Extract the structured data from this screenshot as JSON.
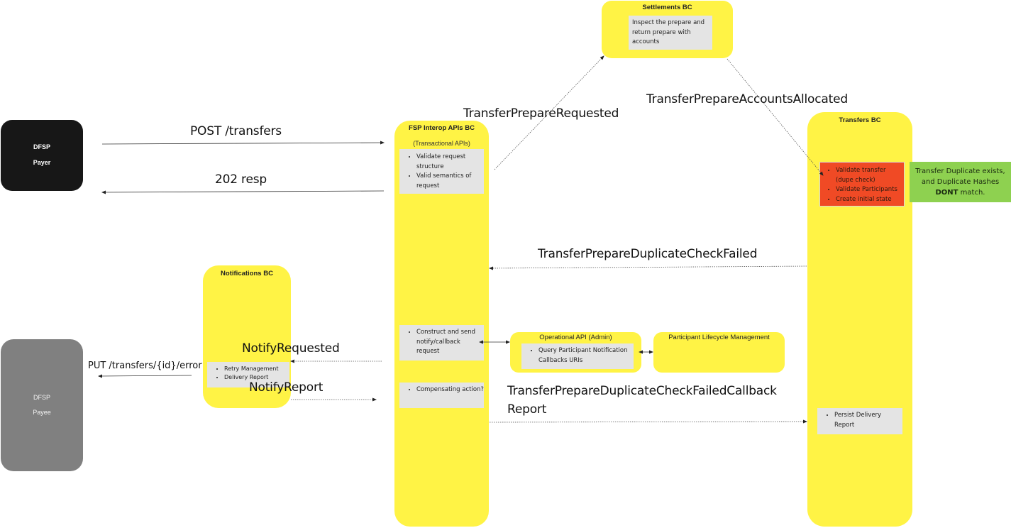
{
  "diagram_title": "",
  "colors": {
    "bounded_context": "#fff345",
    "card": "#e4e4e4",
    "error_card": "#f04a25",
    "note": "#8ed150",
    "payer": "#171717",
    "payee": "#808080"
  },
  "actors": {
    "payer": {
      "line1": "DFSP",
      "line2": "Payer"
    },
    "payee": {
      "line1": "DFSP",
      "line2": "Payee"
    }
  },
  "settlements_bc": {
    "title": "Settlements BC",
    "card_text": "Inspect the prepare and return prepare with accounts"
  },
  "fsp_interop_bc": {
    "title": "FSP Interop APIs BC",
    "subtitle": "(Transactional APIs)",
    "card1": [
      "Validate request structure",
      "Valid semantics of request"
    ],
    "card2": [
      "Construct and send notify/callback request"
    ],
    "card3": [
      "Compensating action?"
    ]
  },
  "transfers_bc": {
    "title": "Transfers BC",
    "error_card": [
      "Validate transfer (dupe check)",
      "Validate Participants",
      "Create initial state"
    ],
    "card2": [
      "Persist Delivery Report"
    ]
  },
  "note": {
    "text_before": "Transfer Duplicate exists, and Duplicate Hashes ",
    "bold": "DONT",
    "text_after": " match."
  },
  "notifications_bc": {
    "title": "Notifications BC",
    "card": [
      "Retry Management",
      "Delivery Report"
    ]
  },
  "operational_api": {
    "title": "Operational API (Admin)",
    "card": [
      "Query Participant Notification Callbacks URIs"
    ]
  },
  "participant_lifecycle": {
    "title": "Participant Lifecycle Management"
  },
  "messages": {
    "post_transfers": "POST /transfers",
    "resp_202": "202 resp",
    "transfer_prepare_requested": "TransferPrepareRequested",
    "transfer_prepare_accounts_allocated": "TransferPrepareAccountsAllocated",
    "duplicate_check_failed": "TransferPrepareDuplicateCheckFailed",
    "duplicate_check_failed_callback_line1": "TransferPrepareDuplicateCheckFailedCallback",
    "duplicate_check_failed_callback_line2": "Report",
    "notify_requested": "NotifyRequested",
    "notify_report": "NotifyReport",
    "put_transfers_error": "PUT /transfers/{id}/error"
  }
}
